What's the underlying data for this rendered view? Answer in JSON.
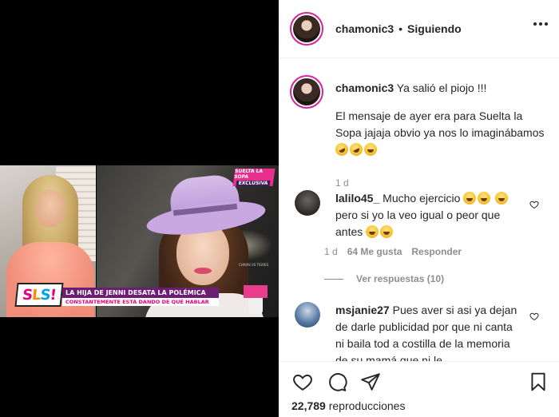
{
  "video": {
    "badge_top": "SUELTA LA SOPA",
    "badge_bottom": "EXCLUSIVA",
    "logo": [
      "S",
      "L",
      "S",
      "!"
    ],
    "headline": "LA HIJA DE JENNI DESATA LA POLÉMICA",
    "subheadline": "CONSTANTEMENTE ESTÁ DANDO DE QUÉ HABLAR",
    "caption_small": "CHIVAS VS TIGRES"
  },
  "header": {
    "username": "chamonic3",
    "separator": "•",
    "follow_status": "Siguiendo",
    "more_icon": "more-horizontal-icon"
  },
  "post_caption": {
    "username": "chamonic3",
    "line1": "Ya salió el piojo !!!",
    "line2": "El mensaje de ayer era para Suelta la Sopa jajaja obvio ya nos lo imaginábamos",
    "emojis": [
      "rolling-on-floor-laughing",
      "rolling-on-floor-laughing",
      "grinning-face-with-smiling-eyes"
    ],
    "time": "1 d"
  },
  "comments": [
    {
      "username": "lalilo45_",
      "text_a": "Mucho ejercicio",
      "text_b": "pero si yo la veo igual o peor que antes",
      "time": "1 d",
      "likes": "64 Me gusta",
      "reply": "Responder",
      "view_replies": "Ver respuestas (10)"
    },
    {
      "username": "msjanie27",
      "text": "Pues aver si asi ya dejan de darle publicidad por que ni canta ni baila tod a costilla de la memoria de su mamá que ni le"
    }
  ],
  "actions": {
    "like_icon": "heart-icon",
    "comment_icon": "comment-icon",
    "share_icon": "paper-plane-icon",
    "save_icon": "bookmark-icon",
    "views_count": "22,789",
    "views_label": "reproducciones"
  },
  "colors": {
    "story_ring": "#d6249f",
    "text": "#262626",
    "muted": "#8e8e8e",
    "lower_third": "#6b1e74",
    "brand_pink": "#e6007e"
  }
}
